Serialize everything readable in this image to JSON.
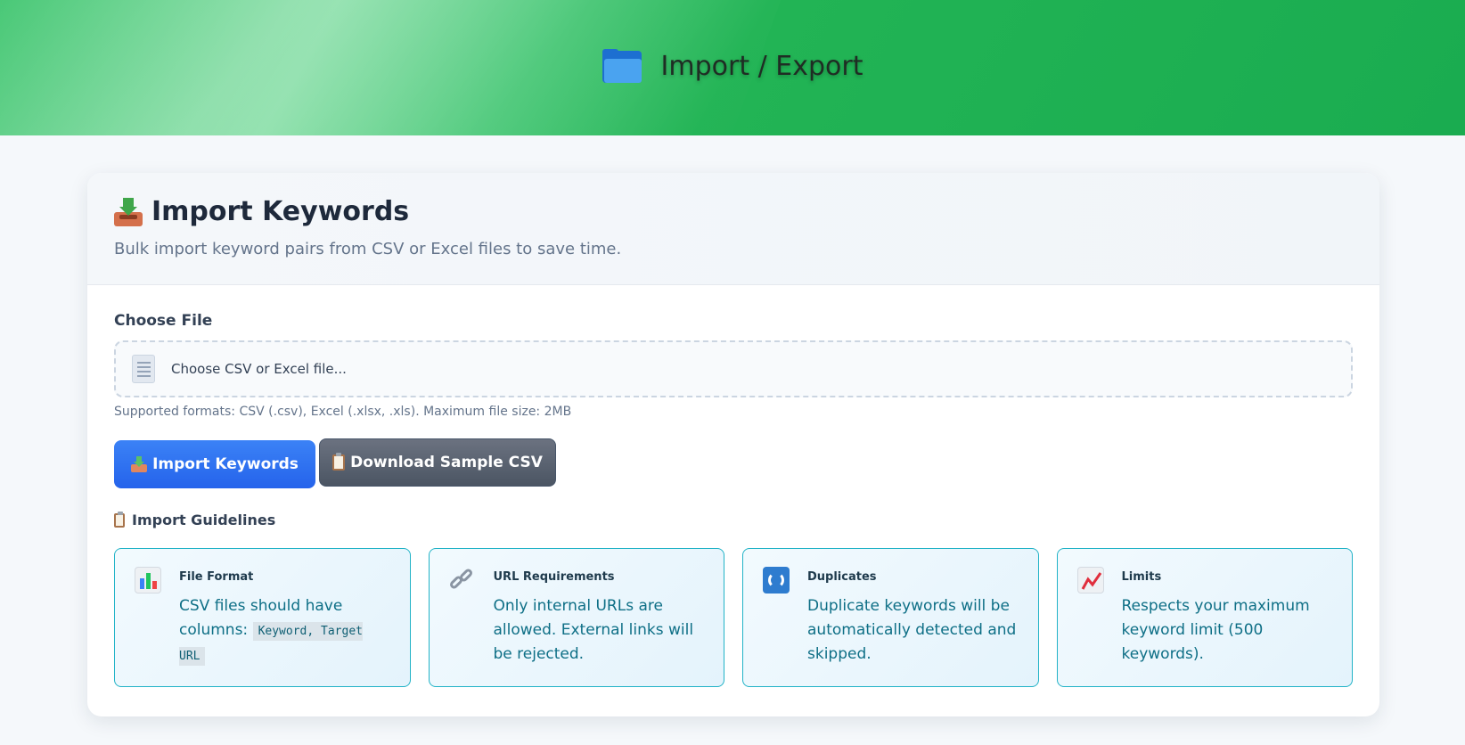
{
  "header": {
    "title": "Import / Export",
    "icon": "folder-icon"
  },
  "import": {
    "title": "Import Keywords",
    "subtitle": "Bulk import keyword pairs from CSV or Excel files to save time.",
    "file_label": "Choose File",
    "file_placeholder": "Choose CSV or Excel file...",
    "help_text": "Supported formats: CSV (.csv), Excel (.xlsx, .xls). Maximum file size: 2MB",
    "import_button": "Import Keywords",
    "sample_button": "Download Sample CSV",
    "guidelines_title": "Import Guidelines"
  },
  "guidelines": [
    {
      "icon": "bar-chart-icon",
      "title": "File Format",
      "text": "CSV files should have columns: ",
      "code": "Keyword, Target URL"
    },
    {
      "icon": "link-icon",
      "title": "URL Requirements",
      "text": "Only internal URLs are allowed. External links will be rejected.",
      "code": ""
    },
    {
      "icon": "refresh-icon",
      "title": "Duplicates",
      "text": "Duplicate keywords will be automatically detected and skipped.",
      "code": ""
    },
    {
      "icon": "trend-chart-icon",
      "title": "Limits",
      "text": "Respects your maximum keyword limit (500 keywords).",
      "code": ""
    }
  ],
  "colors": {
    "primary_button": "#2563eb",
    "secondary_button": "#4b5563",
    "header_green": "#1aac50",
    "guide_border": "#22b3c7",
    "guide_text": "#0e6f86"
  }
}
